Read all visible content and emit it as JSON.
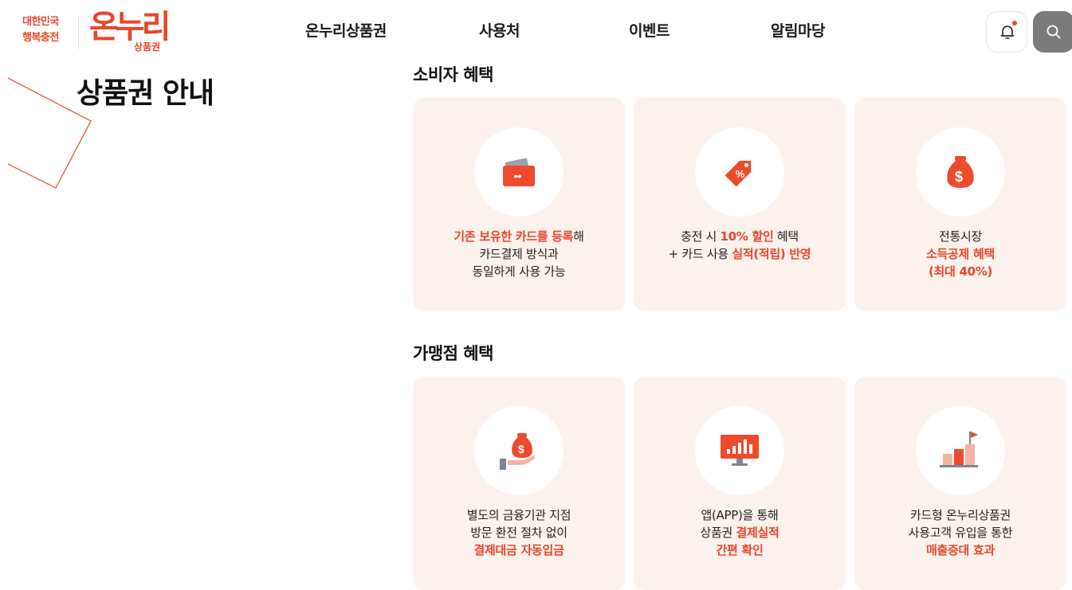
{
  "brand": {
    "tagline_line1": "대한민국",
    "tagline_line2": "행복충전",
    "logo_text": "온누리",
    "logo_sub": "상품권"
  },
  "nav": {
    "items": [
      "온누리상품권",
      "사용처",
      "이벤트",
      "알림마당"
    ]
  },
  "header_icons": {
    "bell": "bell-icon",
    "search": "search-icon"
  },
  "page": {
    "title": "상품권 안내"
  },
  "consumer": {
    "title": "소비자 혜택",
    "cards": [
      {
        "icon": "wallet-card-icon",
        "line1_hl": "기존 보유한 카드를 등록",
        "line1_tail": "해",
        "line2": "카드결제 방식과",
        "line3": "동일하게 사용 가능"
      },
      {
        "icon": "discount-tag-icon",
        "line1_head": "충전 시 ",
        "line1_hl": "10% 할인",
        "line1_tail": " 혜택",
        "line2_head": "+ 카드 사용 ",
        "line2_hl": "실적(적립) 반영"
      },
      {
        "icon": "money-bag-icon",
        "line1": "전통시장",
        "line2_hl": "소득공제 혜택",
        "line3_hl": "(최대 40%)"
      }
    ]
  },
  "merchant": {
    "title": "가맹점 혜택",
    "cards": [
      {
        "icon": "hand-money-bag-icon",
        "line1": "별도의 금융기관 지점",
        "line2": "방문 환전 절차 없이",
        "line3_hl": "결제대금 자동입금"
      },
      {
        "icon": "monitor-chart-icon",
        "line1": "앱(APP)을 통해",
        "line2_head": "상품권 ",
        "line2_hl": "결제실적",
        "line3_hl": "간편 확인"
      },
      {
        "icon": "growth-flag-icon",
        "line1": "카드형 온누리상품권",
        "line2": "사용고객 유입을 통한",
        "line3_hl": "매출증대 효과"
      }
    ]
  },
  "colors": {
    "accent": "#e8462a",
    "card_bg": "#fcf2ed"
  }
}
